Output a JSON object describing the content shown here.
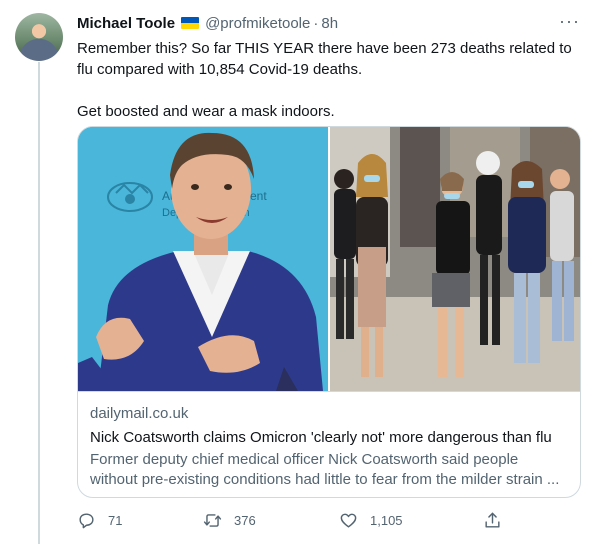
{
  "tweet": {
    "display_name": "Michael Toole",
    "flag_icon": "ukraine-flag-icon",
    "handle": "@profmiketoole",
    "separator": "·",
    "time": "8h",
    "more_label": "···",
    "text_line1": "Remember this? So far THIS YEAR there have been 273 deaths related to flu compared with 10,854 Covid-19 deaths.",
    "text_line2": "Get boosted and wear a mask indoors."
  },
  "card": {
    "domain": "dailymail.co.uk",
    "title": "Nick Coatsworth claims Omicron 'clearly not' more dangerous than flu",
    "description": "Former deputy chief medical officer Nick Coatsworth said people without pre-existing conditions had little to fear from the milder strain ...",
    "left_photo_sign_lines": [
      "Au",
      "Dep",
      "ent",
      "lth"
    ]
  },
  "actions": {
    "reply_count": "71",
    "retweet_count": "376",
    "like_count": "1,105"
  },
  "colors": {
    "text": "#0f1419",
    "muted": "#536471",
    "border": "#cfd9de",
    "flag_blue": "#0057b7",
    "flag_yellow": "#ffd700"
  }
}
